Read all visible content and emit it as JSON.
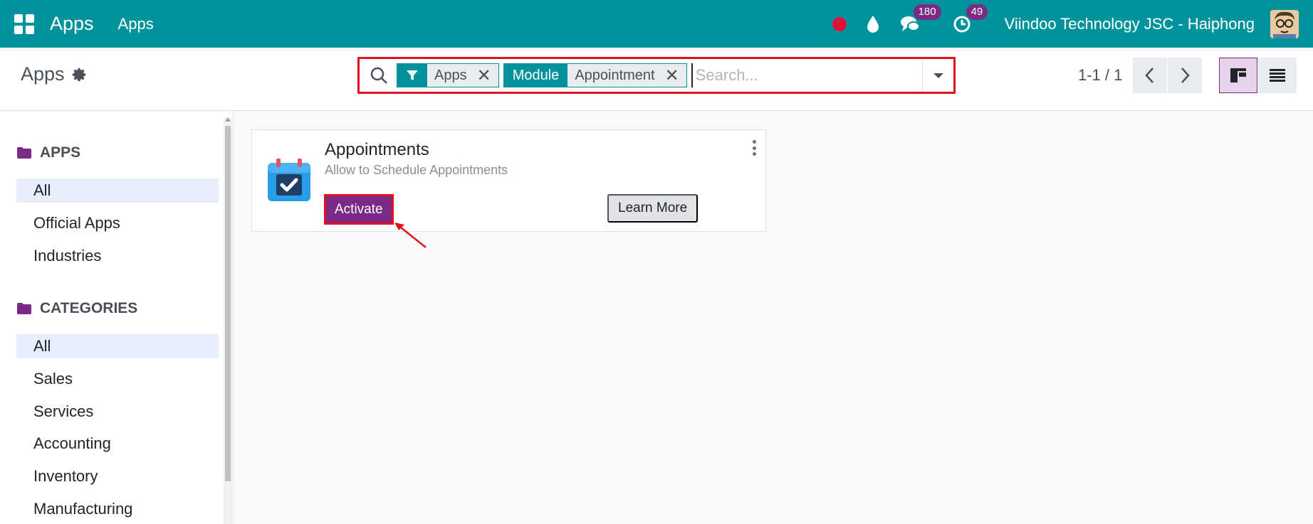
{
  "navbar": {
    "app_title": "Apps",
    "menu_item": "Apps",
    "chat_badge": "180",
    "activity_badge": "49",
    "company": "Viindoo Technology JSC - Haiphong"
  },
  "control": {
    "breadcrumb": "Apps",
    "facets": [
      {
        "tag_icon": "filter-icon",
        "value": "Apps"
      },
      {
        "tag": "Module",
        "value": "Appointment"
      }
    ],
    "search_placeholder": "Search...",
    "pager": "1-1 / 1"
  },
  "sidebar": {
    "apps_heading": "APPS",
    "apps_items": [
      "All",
      "Official Apps",
      "Industries"
    ],
    "categories_heading": "CATEGORIES",
    "category_items": [
      "All",
      "Sales",
      "Services",
      "Accounting",
      "Inventory",
      "Manufacturing"
    ]
  },
  "card": {
    "title": "Appointments",
    "subtitle": "Allow to Schedule Appointments",
    "activate_label": "Activate",
    "learn_more_label": "Learn More"
  },
  "colors": {
    "navbar": "#01939c",
    "accent": "#7b2a87",
    "highlight": "#e0121f"
  }
}
